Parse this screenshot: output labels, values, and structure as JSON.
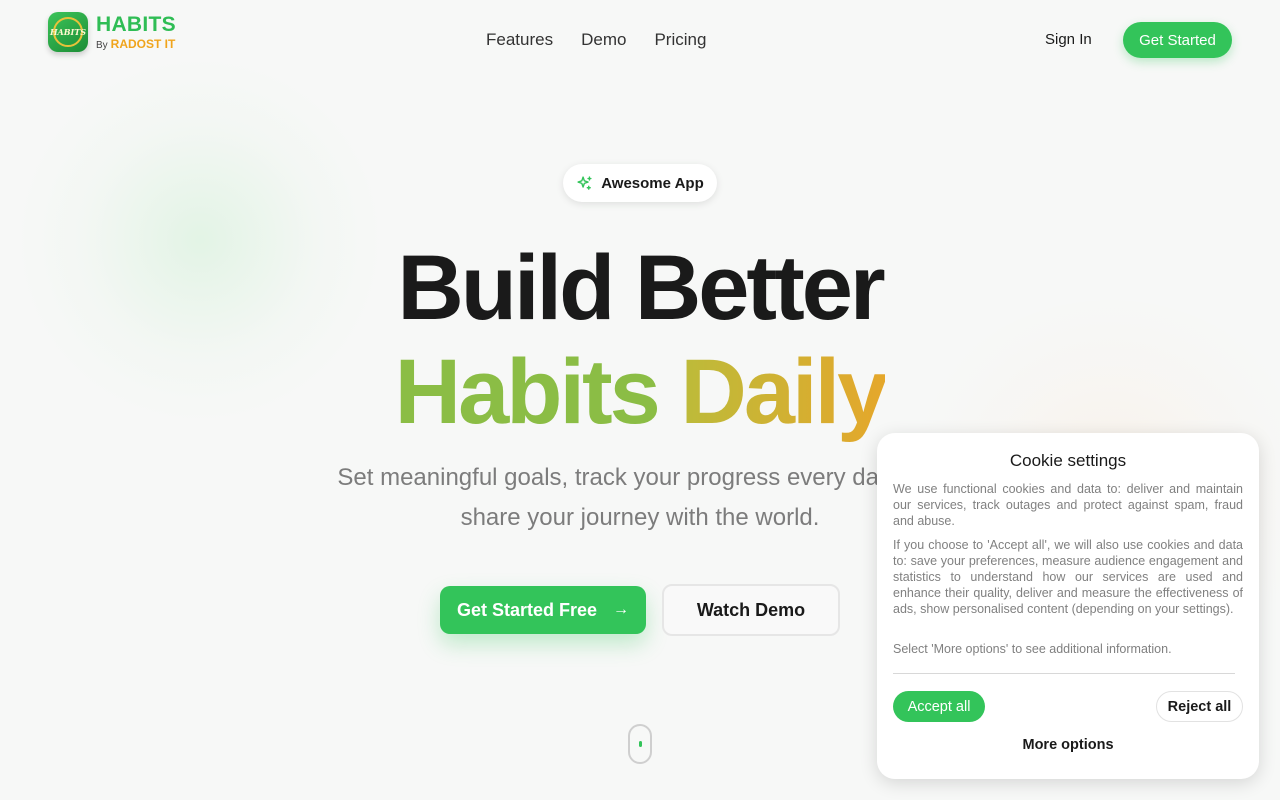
{
  "brand": {
    "title": "HABITS",
    "by": "By",
    "company": "RADOST IT",
    "badge_text": "HABITS"
  },
  "nav": {
    "items": [
      "Features",
      "Demo",
      "Pricing"
    ],
    "sign_in": "Sign In",
    "get_started": "Get Started"
  },
  "hero": {
    "pill_label": "Awesome App",
    "title_line1": "Build Better",
    "title_word_green": "Habits",
    "title_word_gold": "Daily",
    "subtitle_line1": "Set meaningful goals, track your progress every day, and",
    "subtitle_line2": "share your journey with the world.",
    "primary_cta": "Get Started Free",
    "primary_cta_icon": "→",
    "secondary_cta": "Watch Demo"
  },
  "cookie": {
    "title": "Cookie settings",
    "para1": "We use functional cookies and data to: deliver and maintain our services, track outages and protect against spam, fraud and abuse.",
    "para2": "If you choose to 'Accept all', we will also use cookies and data to: save your preferences, measure audience engagement and statistics to understand how our services are used and enhance their quality, deliver and measure the effectiveness of ads, show personalised content (depending on your settings).",
    "para3": "Select 'More options' to see additional information.",
    "accept": "Accept all",
    "reject": "Reject all",
    "more": "More options"
  },
  "colors": {
    "accent": "#33c45a",
    "title_green": "#8bbd45",
    "title_gold": "#e5a72b",
    "brand_orange": "#f0a41c"
  },
  "icons": {
    "pill": "sparkle-icon",
    "cta": "arrow-right-icon",
    "scroll": "scroll-mouse-icon"
  }
}
